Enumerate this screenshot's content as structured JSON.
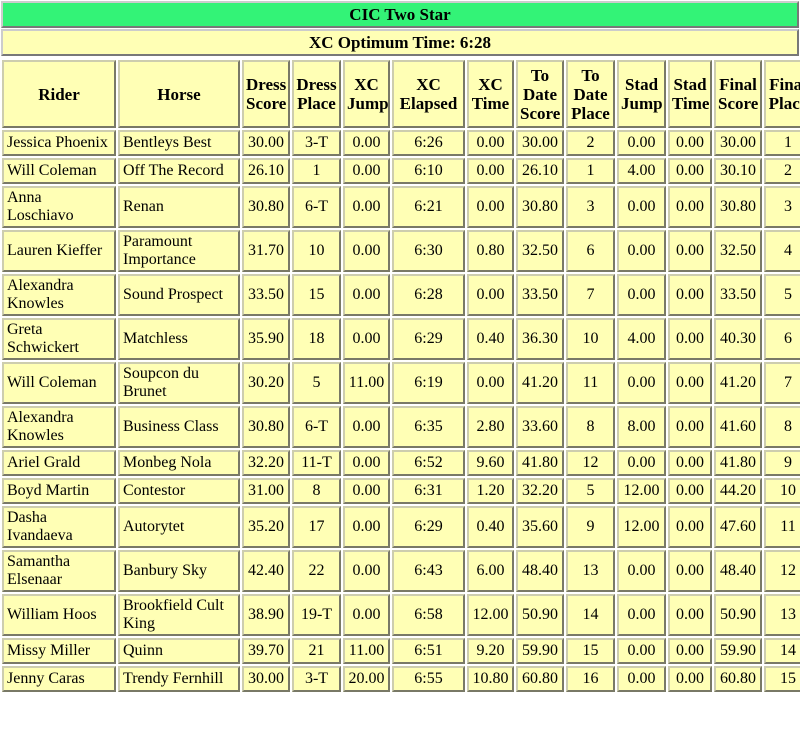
{
  "banner": {
    "title": "CIC Two Star",
    "optimum_time_label": "XC Optimum Time: 6:28",
    "title_bg_color": "#33f377",
    "cell_bg_color": "#ffffb5"
  },
  "table": {
    "columns": [
      "Rider",
      "Horse",
      "Dress Score",
      "Dress Place",
      "XC Jump",
      "XC Elapsed",
      "XC Time",
      "To Date Score",
      "To Date Place",
      "Stad Jump",
      "Stad Time",
      "Final Score",
      "Final Place"
    ],
    "rows": [
      {
        "rider": "Jessica Phoenix",
        "horse": "Bentleys Best",
        "dress_score": "30.00",
        "dress_place": "3-T",
        "xc_jump": "0.00",
        "xc_elapsed": "6:26",
        "xc_time": "0.00",
        "to_date_score": "30.00",
        "to_date_place": "2",
        "stad_jump": "0.00",
        "stad_time": "0.00",
        "final_score": "30.00",
        "final_place": "1"
      },
      {
        "rider": "Will Coleman",
        "horse": "Off The Record",
        "dress_score": "26.10",
        "dress_place": "1",
        "xc_jump": "0.00",
        "xc_elapsed": "6:10",
        "xc_time": "0.00",
        "to_date_score": "26.10",
        "to_date_place": "1",
        "stad_jump": "4.00",
        "stad_time": "0.00",
        "final_score": "30.10",
        "final_place": "2"
      },
      {
        "rider": "Anna Loschiavo",
        "horse": "Renan",
        "dress_score": "30.80",
        "dress_place": "6-T",
        "xc_jump": "0.00",
        "xc_elapsed": "6:21",
        "xc_time": "0.00",
        "to_date_score": "30.80",
        "to_date_place": "3",
        "stad_jump": "0.00",
        "stad_time": "0.00",
        "final_score": "30.80",
        "final_place": "3"
      },
      {
        "rider": "Lauren Kieffer",
        "horse": "Paramount Importance",
        "dress_score": "31.70",
        "dress_place": "10",
        "xc_jump": "0.00",
        "xc_elapsed": "6:30",
        "xc_time": "0.80",
        "to_date_score": "32.50",
        "to_date_place": "6",
        "stad_jump": "0.00",
        "stad_time": "0.00",
        "final_score": "32.50",
        "final_place": "4"
      },
      {
        "rider": "Alexandra Knowles",
        "horse": "Sound Prospect",
        "dress_score": "33.50",
        "dress_place": "15",
        "xc_jump": "0.00",
        "xc_elapsed": "6:28",
        "xc_time": "0.00",
        "to_date_score": "33.50",
        "to_date_place": "7",
        "stad_jump": "0.00",
        "stad_time": "0.00",
        "final_score": "33.50",
        "final_place": "5"
      },
      {
        "rider": "Greta Schwickert",
        "horse": "Matchless",
        "dress_score": "35.90",
        "dress_place": "18",
        "xc_jump": "0.00",
        "xc_elapsed": "6:29",
        "xc_time": "0.40",
        "to_date_score": "36.30",
        "to_date_place": "10",
        "stad_jump": "4.00",
        "stad_time": "0.00",
        "final_score": "40.30",
        "final_place": "6"
      },
      {
        "rider": "Will Coleman",
        "horse": "Soupcon du Brunet",
        "dress_score": "30.20",
        "dress_place": "5",
        "xc_jump": "11.00",
        "xc_elapsed": "6:19",
        "xc_time": "0.00",
        "to_date_score": "41.20",
        "to_date_place": "11",
        "stad_jump": "0.00",
        "stad_time": "0.00",
        "final_score": "41.20",
        "final_place": "7"
      },
      {
        "rider": "Alexandra Knowles",
        "horse": "Business Class",
        "dress_score": "30.80",
        "dress_place": "6-T",
        "xc_jump": "0.00",
        "xc_elapsed": "6:35",
        "xc_time": "2.80",
        "to_date_score": "33.60",
        "to_date_place": "8",
        "stad_jump": "8.00",
        "stad_time": "0.00",
        "final_score": "41.60",
        "final_place": "8"
      },
      {
        "rider": "Ariel Grald",
        "horse": "Monbeg Nola",
        "dress_score": "32.20",
        "dress_place": "11-T",
        "xc_jump": "0.00",
        "xc_elapsed": "6:52",
        "xc_time": "9.60",
        "to_date_score": "41.80",
        "to_date_place": "12",
        "stad_jump": "0.00",
        "stad_time": "0.00",
        "final_score": "41.80",
        "final_place": "9"
      },
      {
        "rider": "Boyd Martin",
        "horse": "Contestor",
        "dress_score": "31.00",
        "dress_place": "8",
        "xc_jump": "0.00",
        "xc_elapsed": "6:31",
        "xc_time": "1.20",
        "to_date_score": "32.20",
        "to_date_place": "5",
        "stad_jump": "12.00",
        "stad_time": "0.00",
        "final_score": "44.20",
        "final_place": "10"
      },
      {
        "rider": "Dasha Ivandaeva",
        "horse": "Autorytet",
        "dress_score": "35.20",
        "dress_place": "17",
        "xc_jump": "0.00",
        "xc_elapsed": "6:29",
        "xc_time": "0.40",
        "to_date_score": "35.60",
        "to_date_place": "9",
        "stad_jump": "12.00",
        "stad_time": "0.00",
        "final_score": "47.60",
        "final_place": "11"
      },
      {
        "rider": "Samantha Elsenaar",
        "horse": "Banbury Sky",
        "dress_score": "42.40",
        "dress_place": "22",
        "xc_jump": "0.00",
        "xc_elapsed": "6:43",
        "xc_time": "6.00",
        "to_date_score": "48.40",
        "to_date_place": "13",
        "stad_jump": "0.00",
        "stad_time": "0.00",
        "final_score": "48.40",
        "final_place": "12"
      },
      {
        "rider": "William Hoos",
        "horse": "Brookfield Cult King",
        "dress_score": "38.90",
        "dress_place": "19-T",
        "xc_jump": "0.00",
        "xc_elapsed": "6:58",
        "xc_time": "12.00",
        "to_date_score": "50.90",
        "to_date_place": "14",
        "stad_jump": "0.00",
        "stad_time": "0.00",
        "final_score": "50.90",
        "final_place": "13"
      },
      {
        "rider": "Missy Miller",
        "horse": "Quinn",
        "dress_score": "39.70",
        "dress_place": "21",
        "xc_jump": "11.00",
        "xc_elapsed": "6:51",
        "xc_time": "9.20",
        "to_date_score": "59.90",
        "to_date_place": "15",
        "stad_jump": "0.00",
        "stad_time": "0.00",
        "final_score": "59.90",
        "final_place": "14"
      },
      {
        "rider": "Jenny Caras",
        "horse": "Trendy Fernhill",
        "dress_score": "30.00",
        "dress_place": "3-T",
        "xc_jump": "20.00",
        "xc_elapsed": "6:55",
        "xc_time": "10.80",
        "to_date_score": "60.80",
        "to_date_place": "16",
        "stad_jump": "0.00",
        "stad_time": "0.00",
        "final_score": "60.80",
        "final_place": "15"
      }
    ]
  }
}
